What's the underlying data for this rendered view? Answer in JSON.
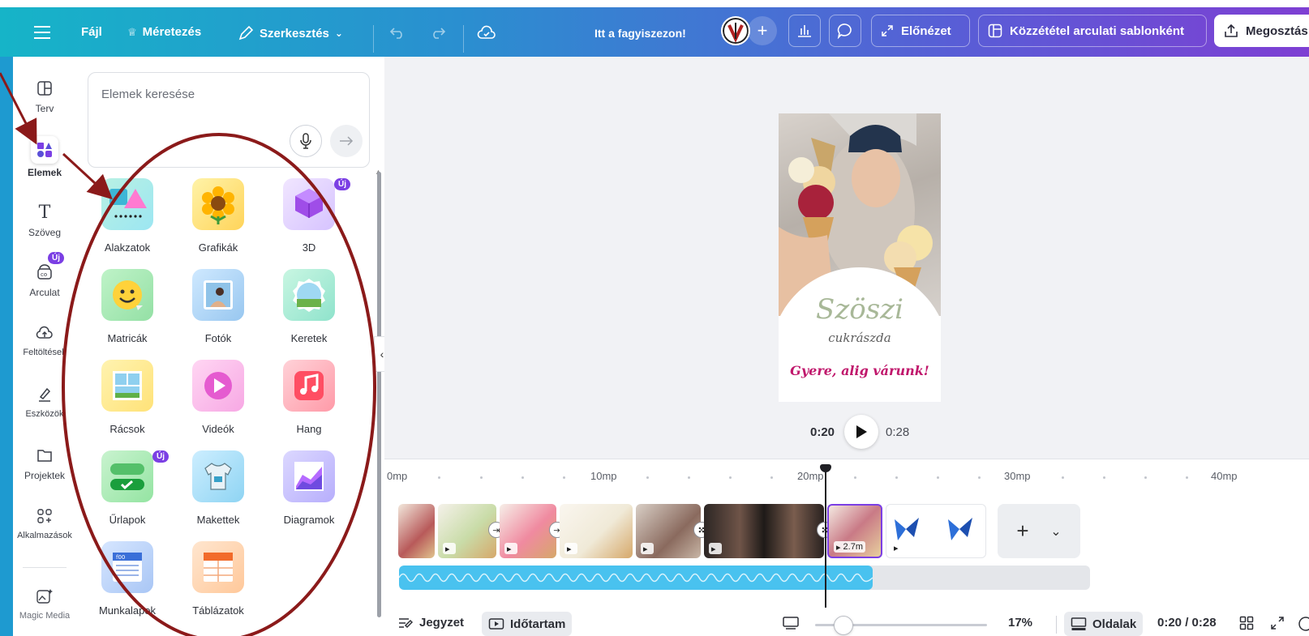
{
  "topbar": {
    "file_label": "Fájl",
    "resize_label": "Méretezés",
    "edit_label": "Szerkesztés",
    "doc_title": "Itt a fagyiszezon!",
    "preview_label": "Előnézet",
    "publish_label": "Közzététel arculati sablonként",
    "share_label": "Megosztás"
  },
  "rail": {
    "items": [
      {
        "label": "Terv",
        "icon": "layout-icon"
      },
      {
        "label": "Elemek",
        "icon": "elements-icon"
      },
      {
        "label": "Szöveg",
        "icon": "text-icon"
      },
      {
        "label": "Arculat",
        "icon": "brand-icon"
      },
      {
        "label": "Feltöltések",
        "icon": "upload-cloud-icon"
      },
      {
        "label": "Eszközök",
        "icon": "draw-icon"
      },
      {
        "label": "Projektek",
        "icon": "folder-icon"
      },
      {
        "label": "Alkalmazások",
        "icon": "apps-icon"
      },
      {
        "label": "Magic Media",
        "icon": "magic-media-icon"
      }
    ],
    "new_badge": "Új"
  },
  "panel": {
    "search_placeholder": "Elemek keresése",
    "tiles": [
      {
        "label": "Alakzatok"
      },
      {
        "label": "Grafikák"
      },
      {
        "label": "3D",
        "badge": "Új"
      },
      {
        "label": "Matricák"
      },
      {
        "label": "Fotók"
      },
      {
        "label": "Keretek"
      },
      {
        "label": "Rácsok"
      },
      {
        "label": "Videók"
      },
      {
        "label": "Hang"
      },
      {
        "label": "Űrlapok",
        "badge": "Új"
      },
      {
        "label": "Makettek"
      },
      {
        "label": "Diagramok"
      },
      {
        "label": "Munkalapok"
      },
      {
        "label": "Táblázatok"
      }
    ]
  },
  "design": {
    "brand_title": "Szöszi",
    "brand_sub": "cukrászda",
    "cta": "Gyere, alig várunk!"
  },
  "player": {
    "current": "0:20",
    "total": "0:28"
  },
  "timeline": {
    "ticks": [
      "0mp",
      "10mp",
      "20mp",
      "30mp",
      "40mp"
    ],
    "selected_clip_duration": "2.7m"
  },
  "bottombar": {
    "notes_label": "Jegyzet",
    "duration_label": "Időtartam",
    "zoom": "17%",
    "pages_label": "Oldalak",
    "time": "0:20 / 0:28"
  },
  "colors": {
    "accent": "#7b3fe4",
    "annotation": "#8b1a1a",
    "audio": "#49c2ef",
    "brand_cta": "#c0186c"
  }
}
